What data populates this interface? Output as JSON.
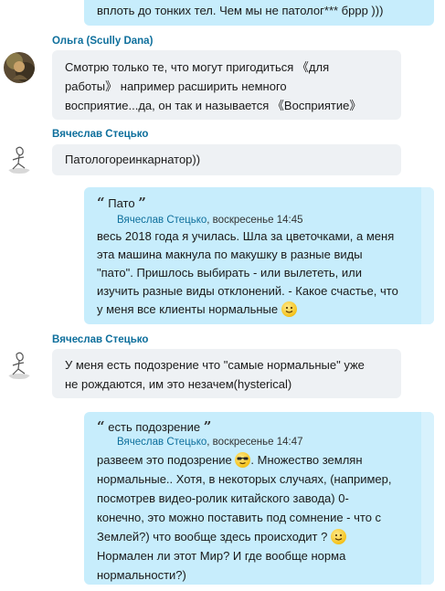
{
  "messages": {
    "top": {
      "line1": "вплоть до тонких тел. Чем мы не патолог*** бррр )))"
    },
    "m1": {
      "sender": "Ольга (Scully Dana)",
      "lines": [
        "Смотрю только те, что могут пригодиться 《для",
        "работы》 например расширить немного",
        "восприятие...да, он так и называется 《Восприятие》"
      ]
    },
    "m2": {
      "sender": "Вячеслав Стецько",
      "lines": [
        "Патологореинкарнатор))"
      ]
    },
    "m3": {
      "quote_text": "Пато",
      "quote_author": "Вячеслав Стецько",
      "quote_time": ", воскресенье 14:45",
      "lines": [
        "весь 2018 года я училась. Шла за цветочками, а меня",
        "эта машина макнула по макушку в разные виды",
        "\"пато\". Пришлось выбирать - или вылететь, или",
        "изучить разные виды отклонений. - Какое счастье, что",
        "у меня все клиенты нормальные"
      ]
    },
    "m4": {
      "sender": "Вячеслав Стецько",
      "lines": [
        "У меня есть подозрение что \"самые нормальные\" уже",
        "не рождаются, им это незачем(hysterical)"
      ]
    },
    "m5": {
      "quote_text": "есть подозрение",
      "quote_author": "Вячеслав Стецько",
      "quote_time": ", воскресенье 14:47",
      "line1": "развеем это подозрение",
      "line1b": ". Множество землян",
      "lines": [
        "нормальные.. Хотя, в некоторых случаях, (например,",
        "посмотрев видео-ролик китайского завода) 0-",
        "конечно, это можно поставить под сомнение - что с"
      ],
      "line5": "Землей?)  что вообще здесь происходит ?",
      "line6": "Нормален ли этот Мир? И где вообще норма",
      "line7": "нормальности?)"
    }
  },
  "icons": {
    "smile": "smile-emoji",
    "cool": "sunglasses-emoji",
    "quote_open": "“",
    "quote_close": "”"
  }
}
